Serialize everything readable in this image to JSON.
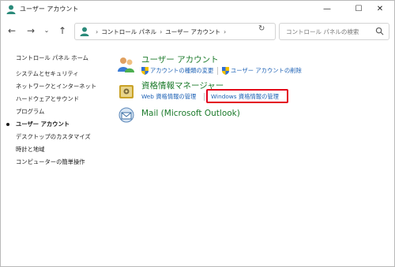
{
  "window": {
    "title": "ユーザー アカウント",
    "minimize_glyph": "—",
    "maximize_glyph": "☐",
    "close_glyph": "✕"
  },
  "nav": {
    "back_glyph": "←",
    "forward_glyph": "→",
    "history_glyph": "⌄",
    "up_glyph": "↑",
    "refresh_glyph": "↻",
    "dropdown_glyph": "⌄"
  },
  "address": {
    "crumbs": [
      "コントロール パネル",
      "ユーザー アカウント"
    ],
    "separator": "›"
  },
  "search": {
    "placeholder": "コントロール パネルの検索"
  },
  "sidebar": {
    "home": "コントロール パネル ホーム",
    "items": [
      "システムとセキュリティ",
      "ネットワークとインターネット",
      "ハードウェアとサウンド",
      "プログラム",
      "ユーザー アカウント",
      "デスクトップのカスタマイズ",
      "時計と地域",
      "コンピューターの簡単操作"
    ],
    "current_index": 4
  },
  "categories": {
    "user_accounts": {
      "title": "ユーザー アカウント",
      "links": [
        "アカウントの種類の変更",
        "ユーザー アカウントの削除"
      ]
    },
    "credential_manager": {
      "title": "資格情報マネージャー",
      "links": [
        "Web 資格情報の管理",
        "Windows 資格情報の管理"
      ]
    },
    "mail": {
      "title": "Mail (Microsoft Outlook)"
    }
  },
  "colors": {
    "category_title": "#1b7a2a",
    "link": "#1a5fb4",
    "highlight_border": "#e3001b"
  }
}
